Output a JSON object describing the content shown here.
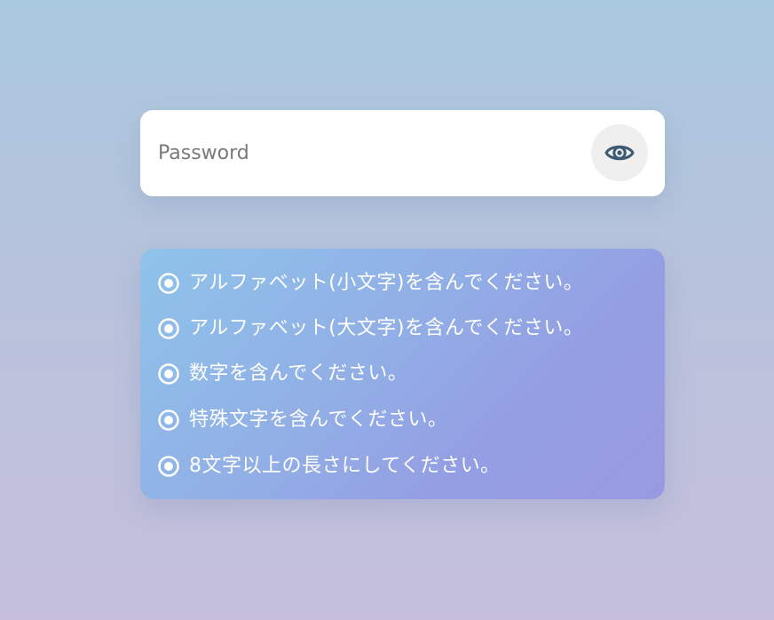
{
  "password": {
    "placeholder": "Password",
    "value": "",
    "toggle_icon": "eye-icon"
  },
  "rules": {
    "icon": "radio-circle-icon",
    "items": [
      {
        "text": "アルファベット(小文字)を含んでください。"
      },
      {
        "text": "アルファベット(大文字)を含んでください。"
      },
      {
        "text": "数字を含んでください。"
      },
      {
        "text": "特殊文字を含んでください。"
      },
      {
        "text": "8文字以上の長さにしてください。"
      }
    ]
  },
  "colors": {
    "eye_icon": "#3d5a73",
    "rules_text": "#ffffff",
    "input_background": "#ffffff",
    "eye_button_background": "#efefef"
  }
}
